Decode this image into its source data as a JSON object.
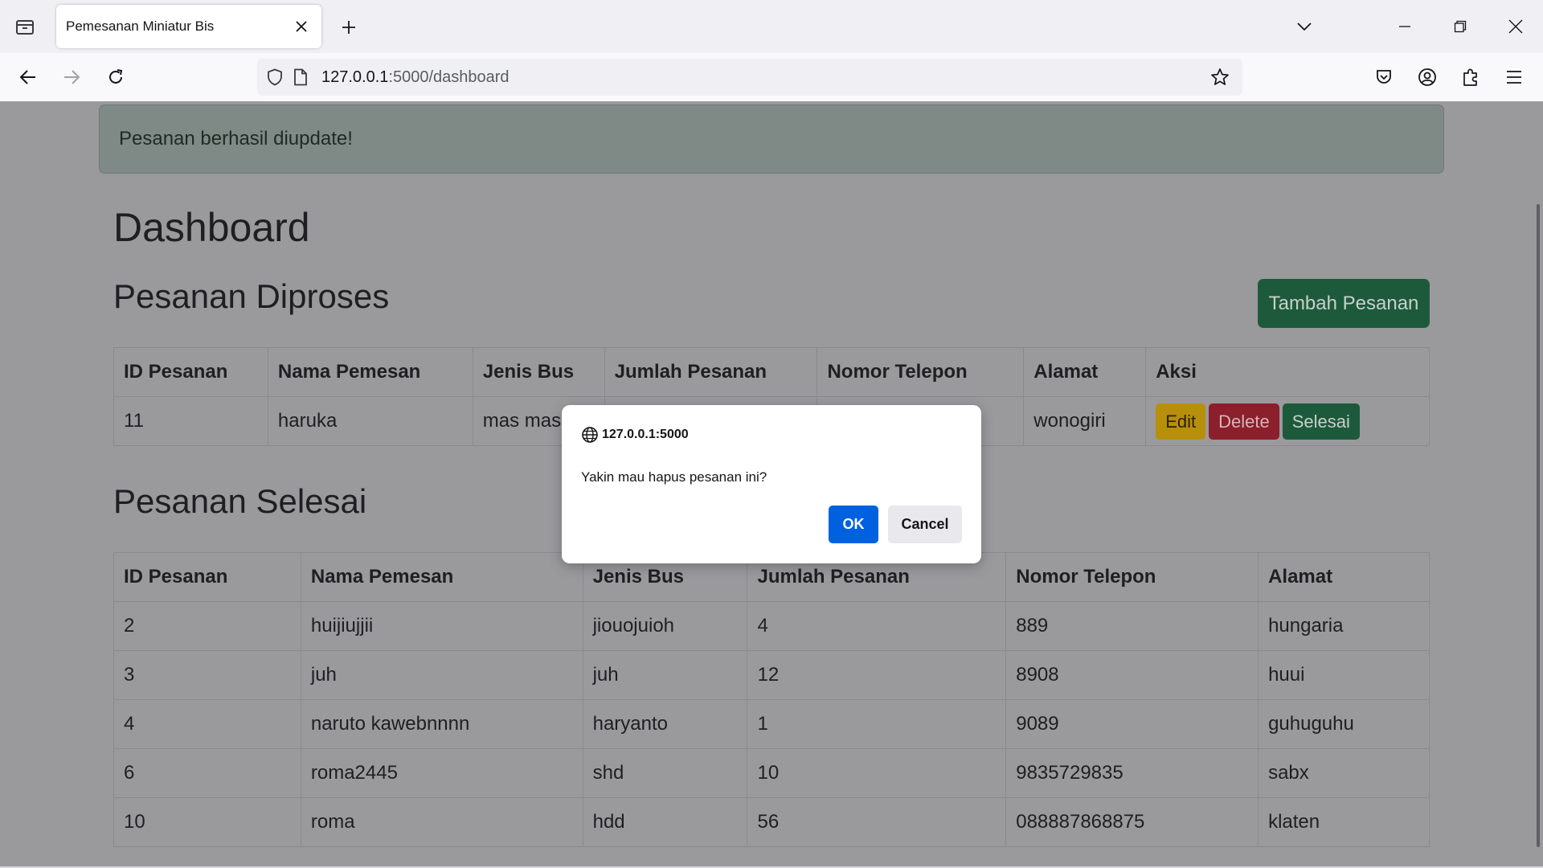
{
  "browser": {
    "tab_title": "Pemesanan Miniatur Bis",
    "url_host": "127.0.0.1",
    "url_path": ":5000/dashboard"
  },
  "alert": {
    "message": "Pesanan berhasil diupdate!"
  },
  "page": {
    "title": "Dashboard",
    "processing_heading": "Pesanan Diproses",
    "add_button": "Tambah Pesanan",
    "done_heading": "Pesanan Selesai"
  },
  "processing_table": {
    "headers": [
      "ID Pesanan",
      "Nama Pemesan",
      "Jenis Bus",
      "Jumlah Pesanan",
      "Nomor Telepon",
      "Alamat",
      "Aksi"
    ],
    "rows": [
      [
        "11",
        "haruka",
        "mas mas",
        "",
        "",
        "wonogiri"
      ]
    ],
    "actions": {
      "edit": "Edit",
      "delete": "Delete",
      "done": "Selesai"
    }
  },
  "done_table": {
    "headers": [
      "ID Pesanan",
      "Nama Pemesan",
      "Jenis Bus",
      "Jumlah Pesanan",
      "Nomor Telepon",
      "Alamat"
    ],
    "rows": [
      [
        "2",
        "huijiujjii",
        "jiouojuioh",
        "4",
        "889",
        "hungaria"
      ],
      [
        "3",
        "juh",
        "juh",
        "12",
        "8908",
        "huui"
      ],
      [
        "4",
        "naruto kawebnnnn",
        "haryanto",
        "1",
        "9089",
        "guhuguhu"
      ],
      [
        "6",
        "roma2445",
        "shd",
        "10",
        "9835729835",
        "sabx"
      ],
      [
        "10",
        "roma",
        "hdd",
        "56",
        "088887868875",
        "klaten"
      ]
    ]
  },
  "dialog": {
    "origin": "127.0.0.1:5000",
    "message": "Yakin mau hapus pesanan ini?",
    "ok_label": "OK",
    "cancel_label": "Cancel"
  },
  "colors": {
    "overlay_background": "#9a9a9d",
    "success_button": "#1d5a3c",
    "danger_button": "#8b1f2c",
    "warning_button": "#b88f0a",
    "dialog_primary": "#0061e0"
  }
}
